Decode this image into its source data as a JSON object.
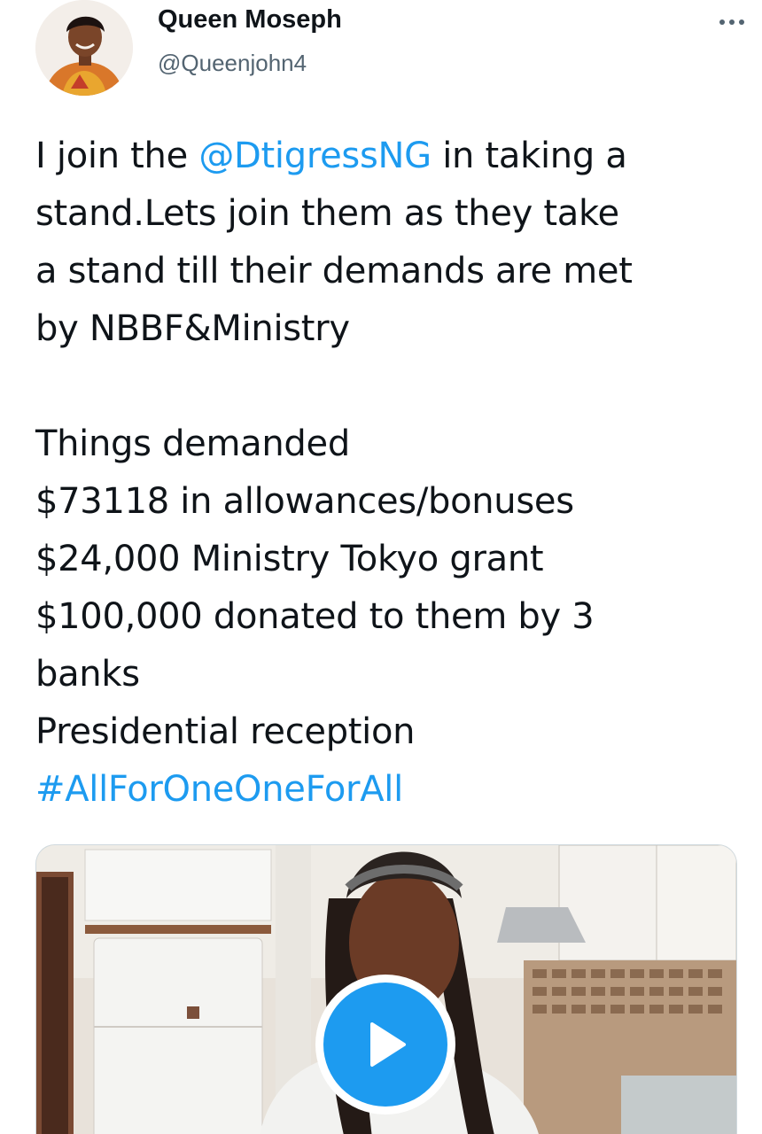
{
  "tweet": {
    "author": {
      "display_name": "Queen Moseph",
      "handle": "@Queenjohn4",
      "avatar_icon": "profile-photo"
    },
    "more_icon": "more-options-icon",
    "text_lines": [
      [
        {
          "text": "I join the "
        },
        {
          "text": "@DtigressNG",
          "link": true
        },
        {
          "text": " in taking a"
        }
      ],
      [
        {
          "text": "stand.Lets join them as they take"
        }
      ],
      [
        {
          "text": "a stand till their demands are met"
        }
      ],
      [
        {
          "text": "by NBBF&Ministry"
        }
      ],
      [],
      [
        {
          "text": "Things demanded"
        }
      ],
      [
        {
          "text": "$73118 in allowances/bonuses"
        }
      ],
      [
        {
          "text": "$24,000 Ministry Tokyo grant"
        }
      ],
      [
        {
          "text": "$100,000 donated to them by 3"
        }
      ],
      [
        {
          "text": "banks"
        }
      ],
      [
        {
          "text": "Presidential reception"
        }
      ],
      [
        {
          "text": "#AllForOneOneForAll",
          "link": true
        }
      ]
    ],
    "media": {
      "type": "video",
      "play_icon": "play-icon"
    }
  },
  "colors": {
    "link": "#1d9bf0",
    "text": "#0f1419",
    "secondary": "#536471",
    "play_button": "#1d9bf0"
  }
}
